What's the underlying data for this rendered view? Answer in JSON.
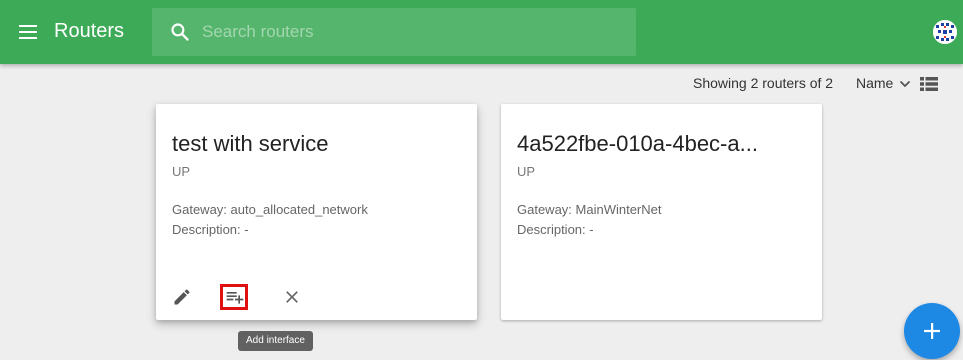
{
  "appbar": {
    "title": "Routers",
    "search_placeholder": "Search routers",
    "menu_icon": "hamburger-menu-icon",
    "search_icon": "search-icon",
    "avatar_icon": "user-avatar-icon",
    "color": "#3daa57"
  },
  "list_toolbar": {
    "count_text": "Showing 2 routers of 2",
    "sort_label": "Name",
    "sort_icon": "chevron-down-icon",
    "view_icon": "list-view-icon"
  },
  "routers": [
    {
      "name": "test with service",
      "status": "UP",
      "gateway": "Gateway: auto_allocated_network",
      "description": "Description: -",
      "actions": [
        "edit-icon",
        "add-interface-icon",
        "delete-icon"
      ]
    },
    {
      "name": "4a522fbe-010a-4bec-a...",
      "status": "UP",
      "gateway": "Gateway: MainWinterNet",
      "description": "Description: -"
    }
  ],
  "tooltip": {
    "text": "Add interface"
  },
  "fab": {
    "icon": "add-icon",
    "color": "#1e88e5"
  }
}
